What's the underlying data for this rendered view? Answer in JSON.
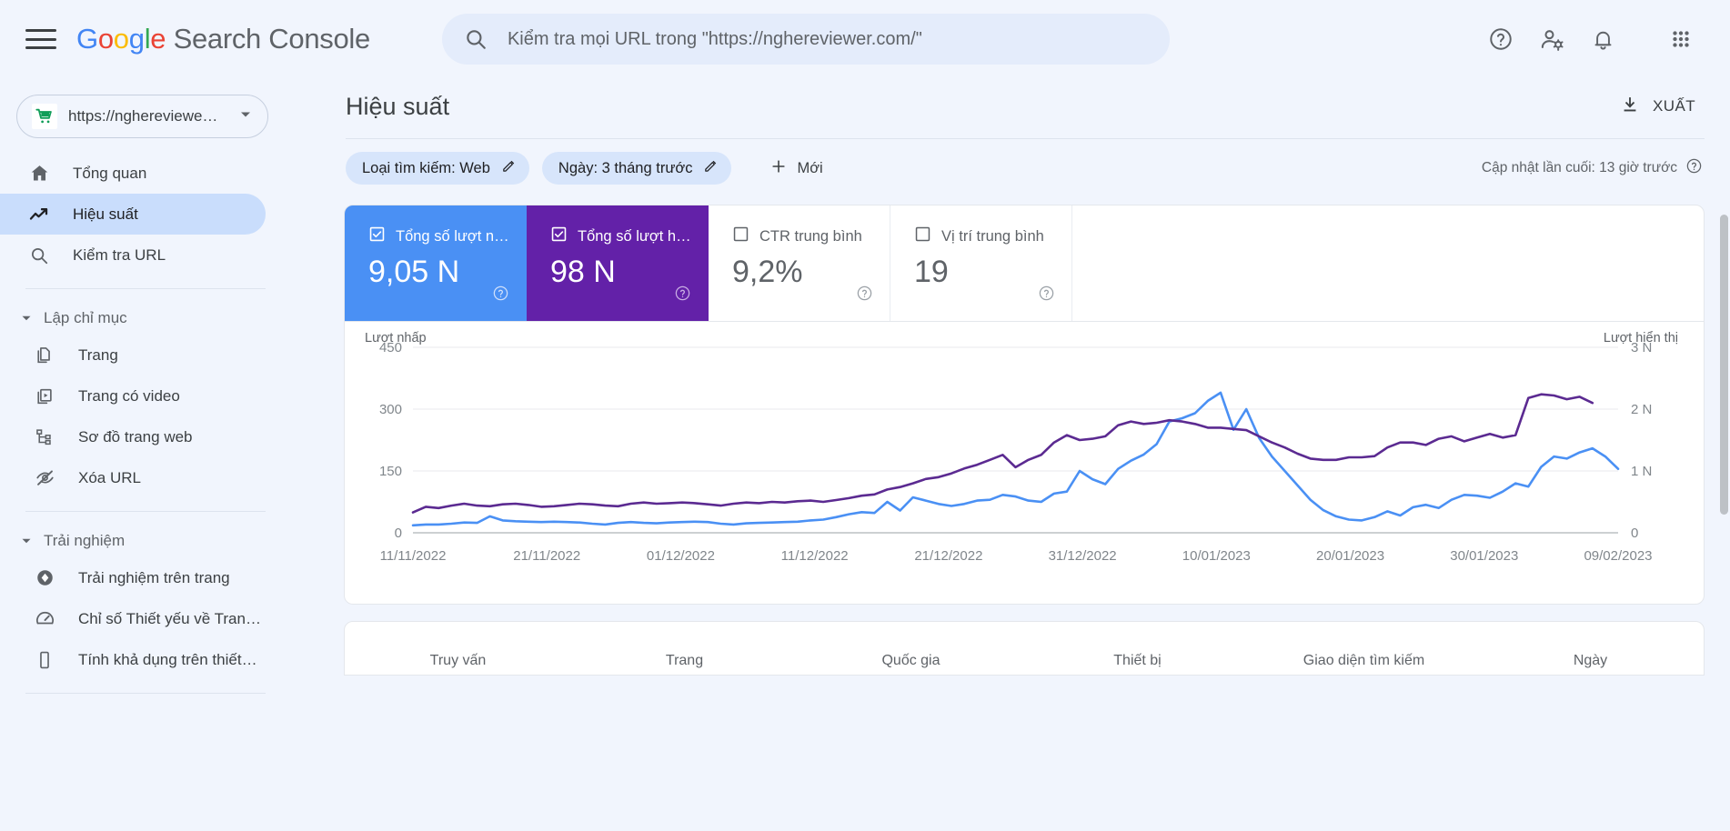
{
  "topbar": {
    "menu_icon": "hamburger-icon",
    "logo_google": "Google",
    "logo_product": "Search Console",
    "search": {
      "icon": "search-icon",
      "placeholder": "Kiểm tra mọi URL trong \"https://nghereviewer.com/\""
    },
    "icons": [
      "help-icon",
      "user-settings-icon",
      "notifications-bell-icon",
      "apps-grid-icon"
    ]
  },
  "sidebar": {
    "property": {
      "icon": "shopping-cart-icon",
      "label": "https://nghereviewe…",
      "caret": "chevron-down-icon"
    },
    "primary_items": [
      {
        "icon": "home-icon",
        "label": "Tổng quan",
        "active": false
      },
      {
        "icon": "trending-up-icon",
        "label": "Hiệu suất",
        "active": true
      },
      {
        "icon": "search-icon",
        "label": "Kiểm tra URL",
        "active": false
      }
    ],
    "groups": [
      {
        "title": "Lập chỉ mục",
        "caret": "caret-down-icon",
        "items": [
          {
            "icon": "pages-icon",
            "label": "Trang"
          },
          {
            "icon": "video-page-icon",
            "label": "Trang có video"
          },
          {
            "icon": "sitemap-icon",
            "label": "Sơ đồ trang web"
          },
          {
            "icon": "eye-off-icon",
            "label": "Xóa URL"
          }
        ]
      },
      {
        "title": "Trải nghiệm",
        "caret": "caret-down-icon",
        "items": [
          {
            "icon": "page-experience-icon",
            "label": "Trải nghiệm trên trang"
          },
          {
            "icon": "speedometer-icon",
            "label": "Chỉ số Thiết yếu về Tran…"
          },
          {
            "icon": "mobile-device-icon",
            "label": "Tính khả dụng trên thiết…"
          }
        ]
      }
    ]
  },
  "main": {
    "page_title": "Hiệu suất",
    "export": {
      "icon": "download-icon",
      "label": "XUẤT"
    },
    "filters": [
      {
        "label": "Loại tìm kiếm: Web",
        "edit_icon": "pencil-icon"
      },
      {
        "label": "Ngày: 3 tháng trước",
        "edit_icon": "pencil-icon"
      }
    ],
    "new_filter": {
      "icon": "plus-icon",
      "label": "Mới"
    },
    "last_updated": {
      "text": "Cập nhật lần cuối: 13 giờ trước",
      "icon": "help-circle-icon"
    },
    "metrics": [
      {
        "label": "Tổng số lượt nh…",
        "value": "9,05 N",
        "checked": true,
        "color": "#4a90f4",
        "help_icon": "help-circle-icon"
      },
      {
        "label": "Tổng số lượt hiể…",
        "value": "98 N",
        "checked": true,
        "color": "#6321a8",
        "help_icon": "help-circle-icon"
      },
      {
        "label": "CTR trung bình",
        "value": "9,2%",
        "checked": false,
        "color": "#5f6368",
        "help_icon": "help-circle-icon"
      },
      {
        "label": "Vị trí trung bình",
        "value": "19",
        "checked": false,
        "color": "#5f6368",
        "help_icon": "help-circle-icon"
      }
    ],
    "bottom_tabs": [
      "Truy vấn",
      "Trang",
      "Quốc gia",
      "Thiết bị",
      "Giao diện tìm kiếm",
      "Ngày"
    ]
  },
  "chart_data": {
    "type": "line",
    "title": "",
    "xlabel": "",
    "ylabel": "Lượt nhấp",
    "y2label": "Lượt hiển thị",
    "grid": true,
    "legend": "none",
    "ylim": [
      0,
      450
    ],
    "yticks": [
      0,
      150,
      300,
      450
    ],
    "ytick_labels": [
      "0",
      "150",
      "300",
      "450"
    ],
    "y2lim": [
      0,
      3000
    ],
    "y2ticks": [
      0,
      1000,
      2000,
      3000
    ],
    "y2tick_labels": [
      "0",
      "1 N",
      "2 N",
      "3 N"
    ],
    "xtick_labels": [
      "11/11/2022",
      "21/11/2022",
      "01/12/2022",
      "11/12/2022",
      "21/12/2022",
      "31/12/2022",
      "10/01/2023",
      "20/01/2023",
      "30/01/2023",
      "09/02/2023"
    ],
    "x_start": "11/11/2022",
    "x_end": "09/02/2023",
    "n_points": 92,
    "series": [
      {
        "name": "Lượt nhấp",
        "color": "#4a90f4",
        "axis": "left",
        "values": [
          18,
          20,
          20,
          22,
          25,
          24,
          40,
          30,
          28,
          27,
          26,
          27,
          26,
          25,
          22,
          20,
          24,
          26,
          24,
          23,
          25,
          26,
          27,
          26,
          22,
          20,
          23,
          24,
          25,
          26,
          27,
          30,
          32,
          38,
          45,
          50,
          48,
          75,
          54,
          86,
          78,
          70,
          65,
          70,
          78,
          80,
          92,
          88,
          78,
          75,
          95,
          100,
          150,
          130,
          118,
          155,
          175,
          190,
          215,
          270,
          278,
          290,
          320,
          340,
          250,
          300,
          230,
          185,
          150,
          115,
          80,
          55,
          40,
          32,
          30,
          38,
          52,
          42,
          62,
          68,
          60,
          80,
          92,
          90,
          85,
          100,
          120,
          112,
          160,
          185,
          180,
          195,
          205,
          185,
          155
        ]
      },
      {
        "name": "Lượt hiển thị",
        "color": "#5b2a91",
        "axis": "right",
        "values": [
          330,
          420,
          400,
          440,
          470,
          440,
          430,
          460,
          470,
          450,
          420,
          430,
          450,
          470,
          460,
          440,
          430,
          470,
          490,
          470,
          480,
          490,
          480,
          460,
          440,
          470,
          490,
          480,
          500,
          490,
          510,
          520,
          500,
          530,
          560,
          600,
          620,
          700,
          740,
          800,
          870,
          900,
          960,
          1040,
          1100,
          1180,
          1260,
          1060,
          1180,
          1260,
          1460,
          1580,
          1500,
          1520,
          1560,
          1740,
          1800,
          1760,
          1780,
          1820,
          1800,
          1760,
          1700,
          1700,
          1680,
          1660,
          1560,
          1460,
          1380,
          1280,
          1200,
          1180,
          1180,
          1220,
          1220,
          1240,
          1380,
          1460,
          1460,
          1420,
          1520,
          1560,
          1480,
          1540,
          1600,
          1540,
          1580,
          2180,
          2240,
          2220,
          2160,
          2200,
          2100
        ]
      }
    ]
  }
}
